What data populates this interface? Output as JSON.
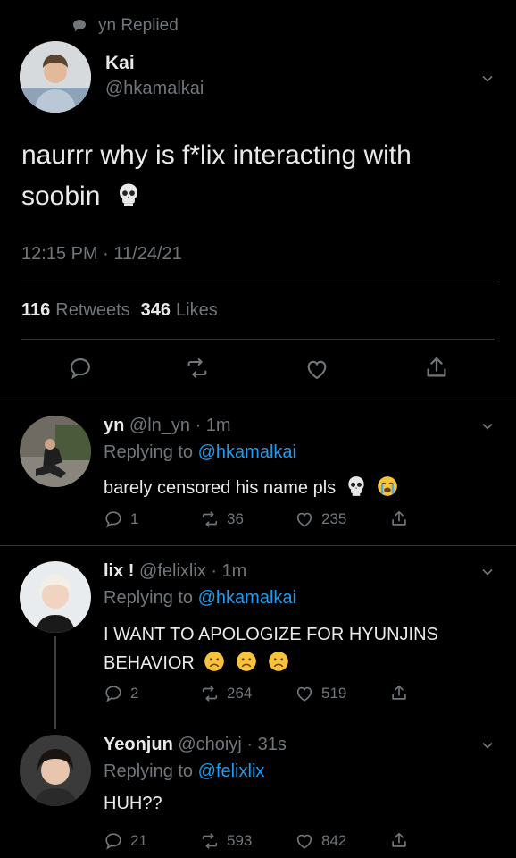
{
  "header": {
    "replied_label": "yn Replied"
  },
  "main_tweet": {
    "display_name": "Kai",
    "handle": "@hkamalkai",
    "text_line1": "naurrr why is f*lix interacting with",
    "text_line2": "soobin",
    "timestamp": "12:15 PM · 11/24/21",
    "retweets_count": "116",
    "retweets_label": "Retweets",
    "likes_count": "346",
    "likes_label": "Likes"
  },
  "replies": [
    {
      "display_name": "yn",
      "handle": "@ln_yn",
      "time": "· 1m",
      "replying_label": "Replying to",
      "replying_to": "@hkamalkai",
      "text": "barely censored his name pls",
      "replies": "1",
      "retweets": "36",
      "likes": "235"
    },
    {
      "display_name": "lix !",
      "handle": "@felixlix",
      "time": "· 1m",
      "replying_label": "Replying to",
      "replying_to": "@hkamalkai",
      "text_line1": "I WANT TO APOLOGIZE FOR HYUNJINS",
      "text_line2": "BEHAVIOR",
      "replies": "2",
      "retweets": "264",
      "likes": "519"
    },
    {
      "display_name": "Yeonjun",
      "handle": "@choiyj",
      "time": "· 31s",
      "replying_label": "Replying to",
      "replying_to": "@felixlix",
      "text": "HUH??",
      "replies": "21",
      "retweets": "593",
      "likes": "842"
    }
  ],
  "colors": {
    "background": "#000000",
    "text": "#e7e9ea",
    "secondary": "#71767b",
    "link": "#1d9bf0",
    "divider": "#2f3336"
  }
}
